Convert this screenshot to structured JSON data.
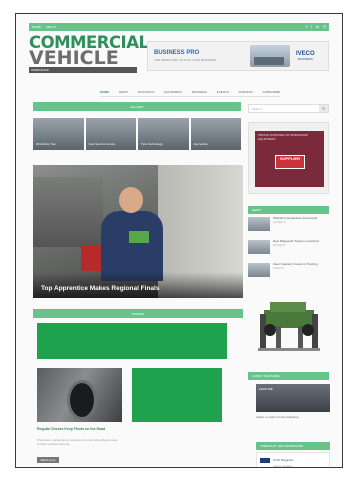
{
  "topbar": {
    "links": [
      "HOME",
      "ABOUT"
    ],
    "social_icons": [
      "facebook-icon",
      "twitter-icon",
      "linkedin-icon",
      "search-icon"
    ],
    "colors": {
      "bar": "#66c38a"
    }
  },
  "logo": {
    "line1": "COMMERCIAL",
    "line2": "VEHICLE",
    "tagline": "WORKSHOP"
  },
  "banner": {
    "headline": "BUSINESS PRO",
    "subline": "THE SMART WAY TO RUN YOUR BUSINESS",
    "brand": "IVECO",
    "brand_sub": "BUSINESS"
  },
  "nav": {
    "items": [
      "HOME",
      "NEWS",
      "TECHNICAL",
      "EQUIPMENT",
      "BUSINESS",
      "EVENTS",
      "TRAINING",
      "SUBSCRIBE"
    ]
  },
  "gallery": {
    "header": "GALLERY",
    "items": [
      "Workshop Tour",
      "New Service Centre",
      "Tyre Technology",
      "Apprentice"
    ]
  },
  "hero": {
    "caption": "Top Apprentice Makes Regional Finals"
  },
  "opinion": {
    "header": "OPINION",
    "article_title": "Regular Checks Keep Fleets on the Road",
    "article_desc": "Preventive maintenance remains the most cost effective way to keep vehicles earning.",
    "read_more": "Read more"
  },
  "sidebar": {
    "search_placeholder": "Search",
    "ad_text": "PROUD SUPPLIER OF WORKSHOP EQUIPMENT",
    "ad_sign": "SUPPLIER",
    "news_header": "NEWS",
    "news": [
      {
        "title": "Workshop Expansion Announced",
        "date": "12 March"
      },
      {
        "title": "New Diagnostic System Launched",
        "date": "10 March"
      },
      {
        "title": "Fleet Operator Invests In Training",
        "date": "8 March"
      }
    ],
    "featured_header": "LATEST FEATURES",
    "featured_image_label": "FEATURE",
    "featured_caption": "Inside a modern truck workshop",
    "feed_header": "TWEETS BY @CVWORKSHOP",
    "feed_name": "CVW Magazine",
    "feed_sub": "Latest updates"
  }
}
